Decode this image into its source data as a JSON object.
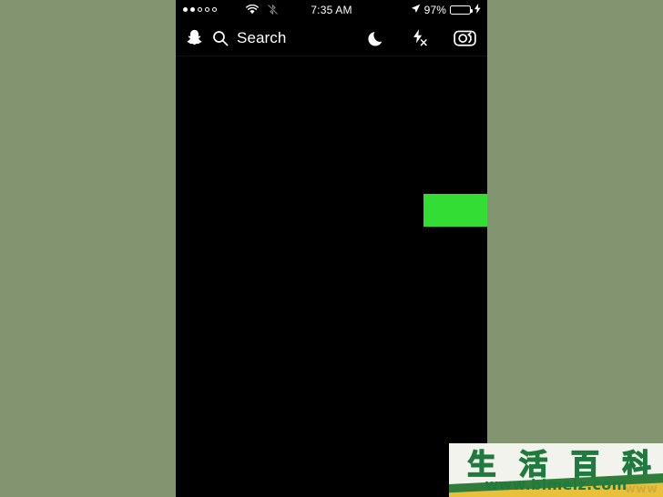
{
  "background": {
    "color": "#839471"
  },
  "phone": {
    "screen_color": "#000000",
    "statusbar": {
      "signal_dots_filled": 2,
      "signal_dots_total": 5,
      "wifi_icon": "wifi-icon",
      "sync_icon": "bluetooth-sync-icon",
      "time": "7:35 AM",
      "location_icon": "location-arrow-icon",
      "battery_percent": "97%",
      "battery_level": 97,
      "battery_color": "#3ac23a",
      "charging_icon": "lightning-bolt-icon"
    },
    "appbar": {
      "ghost_icon": "snapchat-ghost-icon",
      "search_icon": "search-icon",
      "search_label": "Search",
      "night_icon": "crescent-moon-icon",
      "flash_icon": "flash-off-icon",
      "flip_camera_icon": "flip-camera-icon"
    },
    "annotation": {
      "arrow_icon": "right-arrow-annotation",
      "arrow_color": "#33dd33",
      "direction": "right"
    },
    "shutter": {
      "label": "capture-button",
      "color": "#ffffff"
    }
  },
  "watermark": {
    "characters": [
      "生",
      "活",
      "百",
      "科"
    ],
    "url": "www.bimeiz.com",
    "accent_color": "#1f7a3d",
    "band_green": "#2f7d3a",
    "band_yellow": "#e8c03a",
    "shadow_text": "www"
  }
}
